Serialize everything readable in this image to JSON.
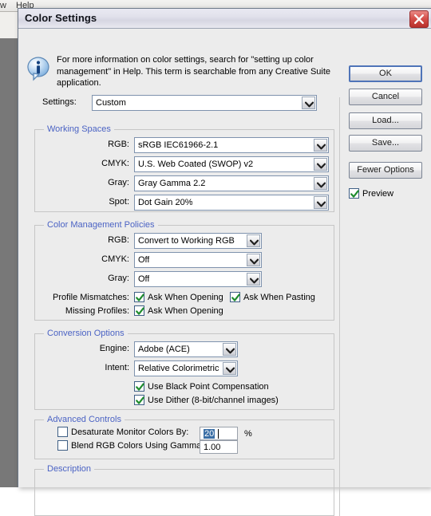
{
  "background": {
    "menu_window": "w",
    "menu_help": "Help"
  },
  "dialog": {
    "title": "Color Settings",
    "close_icon": "close-icon",
    "info_icon": "info-icon",
    "info_text": "For more information on color settings, search for \"setting up color management\" in Help. This term is searchable from any Creative Suite application.",
    "settings": {
      "label": "Settings:",
      "value": "Custom"
    }
  },
  "working_spaces": {
    "title": "Working Spaces",
    "rows": [
      {
        "label": "RGB:",
        "value": "sRGB IEC61966-2.1"
      },
      {
        "label": "CMYK:",
        "value": "U.S. Web Coated (SWOP) v2"
      },
      {
        "label": "Gray:",
        "value": "Gray Gamma 2.2"
      },
      {
        "label": "Spot:",
        "value": "Dot Gain 20%"
      }
    ]
  },
  "policies": {
    "title": "Color Management Policies",
    "rows": [
      {
        "label": "RGB:",
        "value": "Convert to Working RGB"
      },
      {
        "label": "CMYK:",
        "value": "Off"
      },
      {
        "label": "Gray:",
        "value": "Off"
      }
    ],
    "profile_mismatches_label": "Profile Mismatches:",
    "missing_profiles_label": "Missing Profiles:",
    "ask_when_opening": "Ask When Opening",
    "ask_when_pasting": "Ask When Pasting",
    "ask_when_opening_2": "Ask When Opening"
  },
  "conversion": {
    "title": "Conversion Options",
    "rows": [
      {
        "label": "Engine:",
        "value": "Adobe (ACE)"
      },
      {
        "label": "Intent:",
        "value": "Relative Colorimetric"
      }
    ],
    "black_point_label": "Use Black Point Compensation",
    "dither_label": "Use Dither (8-bit/channel images)"
  },
  "advanced": {
    "title": "Advanced Controls",
    "desaturate_label": "Desaturate Monitor Colors By:",
    "desaturate_value": "20",
    "percent_symbol": "%",
    "blend_label": "Blend RGB Colors Using Gamma:",
    "blend_value": "1.00"
  },
  "description": {
    "title": "Description",
    "text": ""
  },
  "buttons": {
    "ok": "OK",
    "cancel": "Cancel",
    "load": "Load...",
    "save": "Save...",
    "fewer_options": "Fewer Options",
    "preview": "Preview"
  },
  "colors": {
    "accent_group_title": "#4b63c4",
    "checkmark_green": "#1f8c2e",
    "close_red": "#c23b36",
    "default_button_blue": "#4f74b8",
    "selection_blue": "#3a6ea5"
  }
}
